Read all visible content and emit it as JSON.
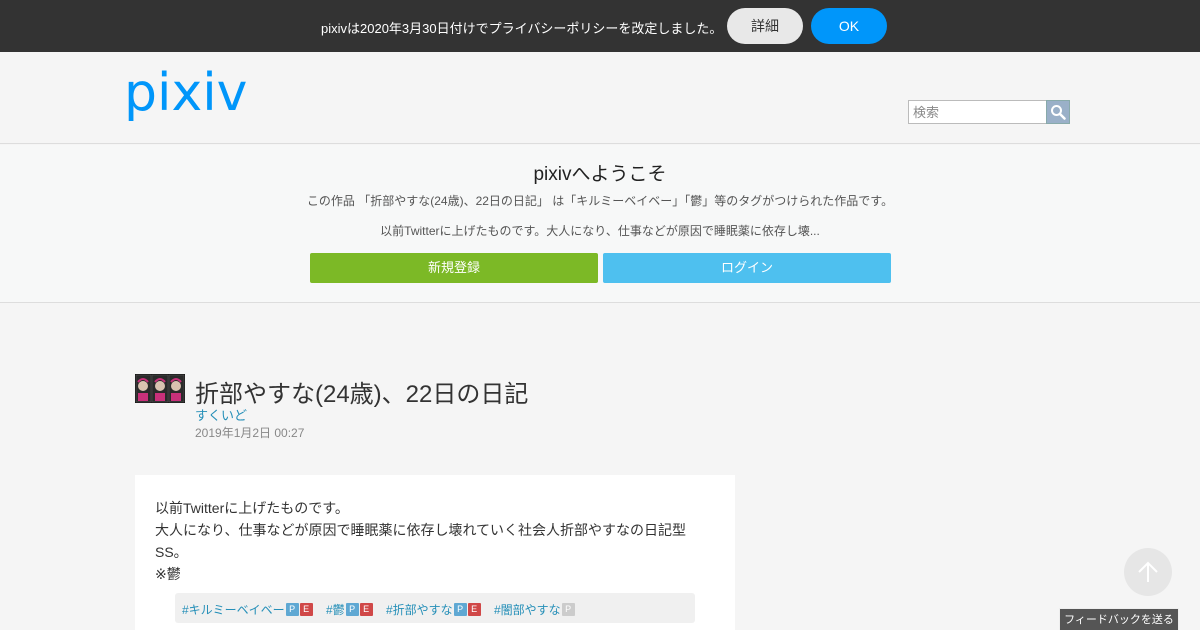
{
  "notice": {
    "text": "pixivは2020年3月30日付けでプライバシーポリシーを改定しました。",
    "detail_label": "詳細",
    "ok_label": "OK"
  },
  "header": {
    "logo_text": "pixiv",
    "search_placeholder": "検索"
  },
  "welcome": {
    "title": "pixivへようこそ",
    "description": "この作品 「折部やすな(24歳)、22日の日記」 は「キルミーベイベー」「鬱」等のタグがつけられた作品です。",
    "excerpt": "以前Twitterに上げたものです。大人になり、仕事などが原因で睡眠薬に依存し壊...",
    "register_label": "新規登録",
    "login_label": "ログイン"
  },
  "work": {
    "title": "折部やすな(24歳)、22日の日記",
    "author": "すくいど",
    "date": "2019年1月2日 00:27",
    "caption": [
      "以前Twitterに上げたものです。",
      "大人になり、仕事などが原因で睡眠薬に依存し壊れていく社会人折部やすなの日記型",
      "SS。",
      "※鬱"
    ],
    "tags": [
      {
        "label": "#キルミーベイベー",
        "p_icon": "P",
        "e_icon": "E"
      },
      {
        "label": "#鬱",
        "p_icon": "P",
        "e_icon": "E"
      },
      {
        "label": "#折部やすな",
        "p_icon": "P",
        "e_icon": "E"
      },
      {
        "label": "#闇部やすな",
        "p_icon": "P"
      }
    ]
  },
  "footer": {
    "feedback_label": "フィードバックを送る",
    "scroll_top_icon": "arrow-up-icon"
  },
  "colors": {
    "notice_bg": "#333333",
    "ok_blue": "#0096fa",
    "register_green": "#7cb926",
    "login_blue": "#4ec0ef",
    "logo_blue": "#0096fa",
    "link_blue": "#258fb8"
  }
}
